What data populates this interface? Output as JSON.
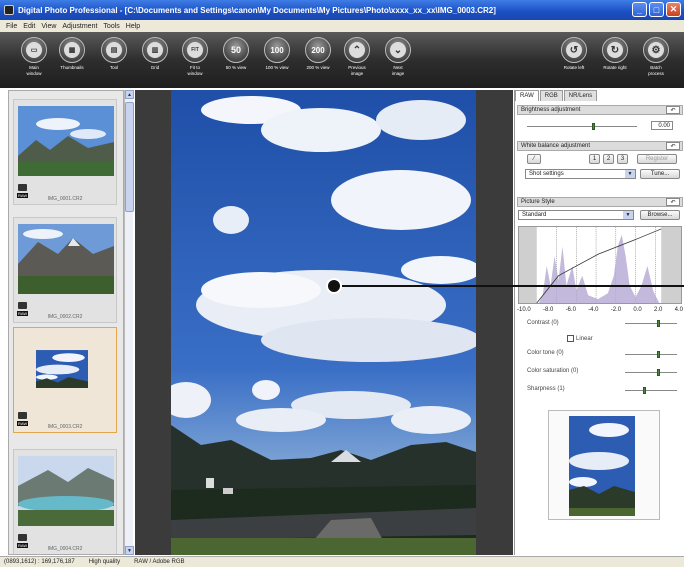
{
  "window": {
    "title": "Digital Photo Professional - [C:\\Documents and Settings\\canon\\My Documents\\My Pictures\\Photo\\xxxx_xx_xx\\IMG_0003.CR2]",
    "minimize": "_",
    "maximize": "□",
    "close": "✕"
  },
  "menu": [
    "File",
    "Edit",
    "View",
    "Adjustment",
    "Tools",
    "Help"
  ],
  "toolbar": [
    {
      "label": "Main\nwindow",
      "glyph": "▭",
      "icon": "main-window-icon"
    },
    {
      "label": "Thumbnails",
      "glyph": "▦",
      "icon": "thumbnails-icon"
    },
    {
      "label": "Tool",
      "glyph": "▤",
      "icon": "tool-icon"
    },
    {
      "label": "Grid",
      "glyph": "▥",
      "icon": "grid-icon"
    },
    {
      "label": "Fit to\nwindow",
      "glyph": "FIT",
      "icon": "fit-to-window-icon"
    },
    {
      "label": "50 % view",
      "glyph": "50",
      "icon": "zoom-50-icon"
    },
    {
      "label": "100 % view",
      "glyph": "100",
      "icon": "zoom-100-icon"
    },
    {
      "label": "200 % view",
      "glyph": "200",
      "icon": "zoom-200-icon"
    },
    {
      "label": "Previous\nimage",
      "glyph": "⌃",
      "icon": "previous-image-icon"
    },
    {
      "label": "Next\nimage",
      "glyph": "⌄",
      "icon": "next-image-icon"
    },
    {
      "label": "Rotate left",
      "glyph": "↺",
      "icon": "rotate-left-icon"
    },
    {
      "label": "Rotate right",
      "glyph": "↻",
      "icon": "rotate-right-icon"
    },
    {
      "label": "Batch\nprocess",
      "glyph": "⚙",
      "icon": "batch-process-icon"
    }
  ],
  "thumbnails": [
    {
      "filename": "IMG_0001.CR2",
      "badge": "RAW",
      "selected": false
    },
    {
      "filename": "IMG_0002.CR2",
      "badge": "RAW",
      "selected": false
    },
    {
      "filename": "IMG_0003.CR2",
      "badge": "RAW",
      "selected": true
    },
    {
      "filename": "IMG_0004.CR2",
      "badge": "RAW",
      "selected": false
    }
  ],
  "palette": {
    "tabs": [
      "RAW",
      "RGB",
      "NR/Lens"
    ],
    "active_tab": "RAW",
    "reset_glyph": "↶",
    "brightness": {
      "title": "Brightness adjustment",
      "value": "0.00"
    },
    "white_balance": {
      "title": "White balance adjustment",
      "presets": [
        "1",
        "2",
        "3"
      ],
      "register": "Register",
      "mode": "Shot settings",
      "tune": "Tune..."
    },
    "picture_style": {
      "title": "Picture Style",
      "style": "Standard",
      "browse": "Browse...",
      "axis_ticks": [
        "-10.0",
        "-8.0",
        "-6.0",
        "-4.0",
        "-2.0",
        "0.0",
        "2.0",
        "4.0"
      ],
      "contrast": "Contrast (0)",
      "linear": "Linear",
      "color_tone": "Color tone (0)",
      "color_saturation": "Color saturation (0)",
      "sharpness": "Sharpness (1)"
    }
  },
  "status": {
    "coords": "(0893,1612) : 169,176,187",
    "quality": "High quality",
    "profile": "RAW / Adobe RGB"
  }
}
